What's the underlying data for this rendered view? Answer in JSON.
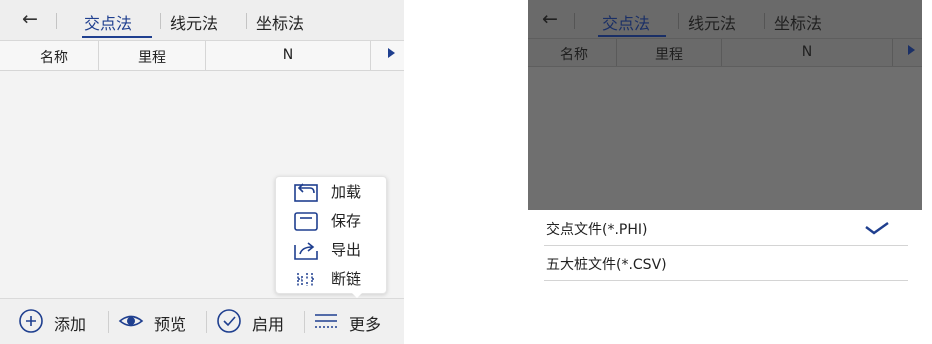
{
  "left": {
    "back_icon": "←",
    "tabs": [
      {
        "label": "交点法",
        "active": true
      },
      {
        "label": "线元法",
        "active": false
      },
      {
        "label": "坐标法",
        "active": false
      }
    ],
    "columns": [
      "名称",
      "里程",
      "N"
    ],
    "scroll_right_icon": "play-right-icon",
    "popup_menu": [
      {
        "label": "加载",
        "icon": "load-icon"
      },
      {
        "label": "保存",
        "icon": "save-icon"
      },
      {
        "label": "导出",
        "icon": "export-icon"
      },
      {
        "label": "断链",
        "icon": "break-chain-icon"
      }
    ],
    "bottom_bar": [
      {
        "label": "添加",
        "icon": "add-circle-icon"
      },
      {
        "label": "预览",
        "icon": "eye-icon"
      },
      {
        "label": "启用",
        "icon": "check-circle-icon"
      },
      {
        "label": "更多",
        "icon": "more-lines-icon"
      }
    ]
  },
  "right": {
    "back_icon": "←",
    "tabs": [
      {
        "label": "交点法",
        "active": true
      },
      {
        "label": "线元法",
        "active": false
      },
      {
        "label": "坐标法",
        "active": false
      }
    ],
    "columns": [
      "名称",
      "里程",
      "N"
    ],
    "file_options": [
      {
        "label": "交点文件(*.PHI)",
        "selected": true
      },
      {
        "label": "五大桩文件(*.CSV)",
        "selected": false
      }
    ]
  },
  "colors": {
    "accent": "#1f3f8f",
    "overlay": "#6f6f6f",
    "bar_bg": "#eeeeee"
  }
}
